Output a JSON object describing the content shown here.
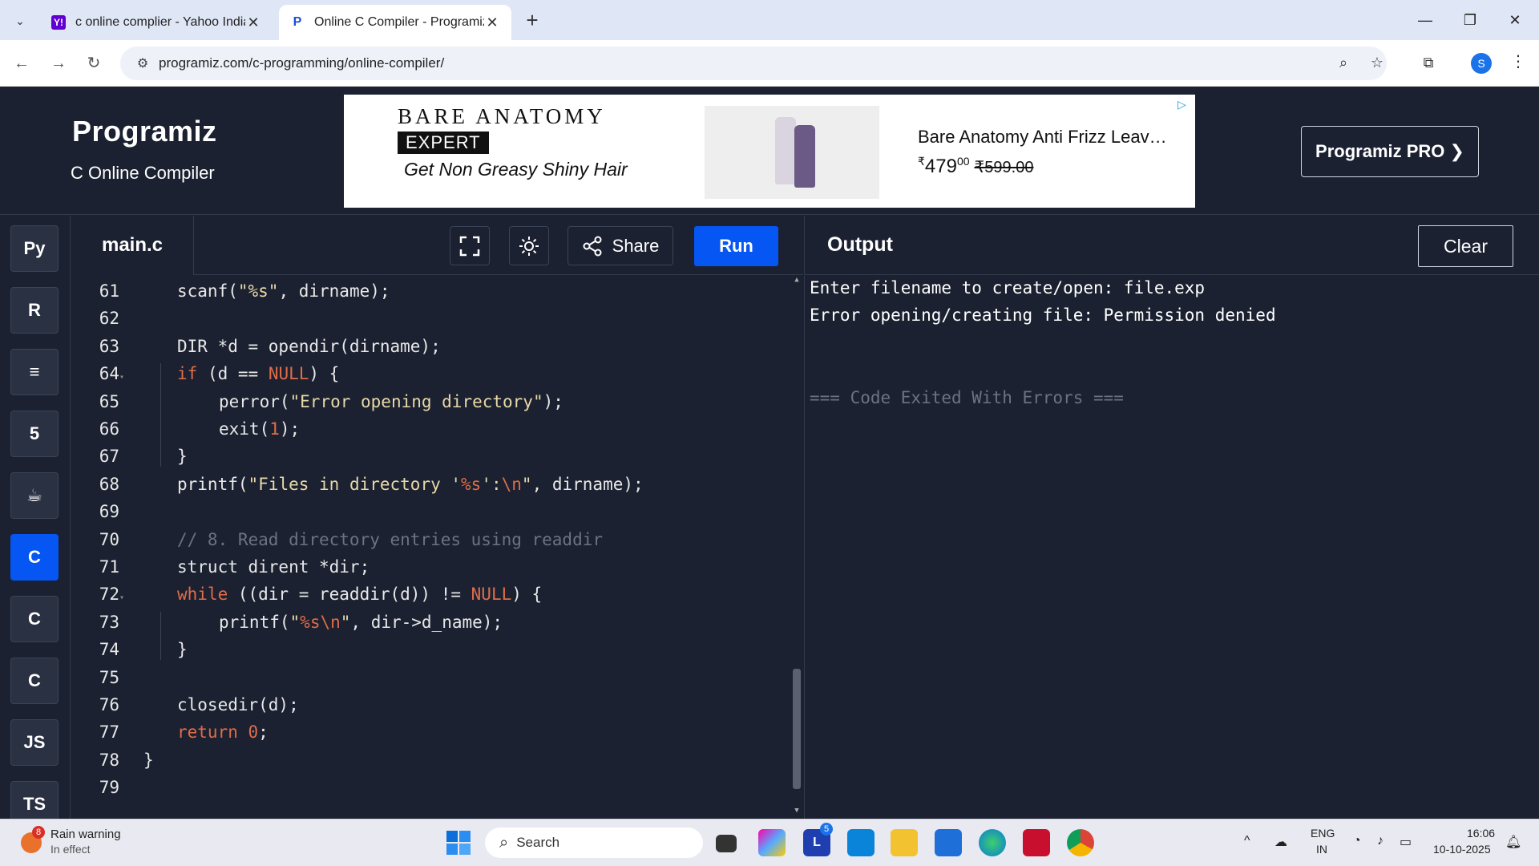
{
  "browser": {
    "tabs": [
      {
        "title": "c online complier - Yahoo India",
        "active": false
      },
      {
        "title": "Online C Compiler - Programiz",
        "active": true
      }
    ],
    "url": "programiz.com/c-programming/online-compiler/",
    "profile_initial": "S"
  },
  "header": {
    "logo": "Programiz",
    "subtitle": "C Online Compiler",
    "pro_button": "Programiz PRO ❯",
    "ad": {
      "brand": "BARE ANATOMY",
      "badge": "EXPERT",
      "tagline": "Get Non Greasy Shiny Hair",
      "product": "Bare Anatomy Anti Frizz Leav…",
      "price_symbol": "₹",
      "price_main": "479",
      "price_cents": "00",
      "old_price": "₹599.00"
    }
  },
  "sidebar": {
    "languages": [
      {
        "name": "python-icon",
        "label": "Py",
        "active": false
      },
      {
        "name": "r-icon",
        "label": "R",
        "active": false
      },
      {
        "name": "sql-icon",
        "label": "≡",
        "active": false
      },
      {
        "name": "html5-icon",
        "label": "5",
        "active": false
      },
      {
        "name": "java-icon",
        "label": "☕",
        "active": false
      },
      {
        "name": "c-icon",
        "label": "C",
        "active": true
      },
      {
        "name": "cpp-icon",
        "label": "C",
        "active": false
      },
      {
        "name": "csharp-icon",
        "label": "C",
        "active": false
      },
      {
        "name": "js-icon",
        "label": "JS",
        "active": false
      },
      {
        "name": "ts-icon",
        "label": "TS",
        "active": false
      }
    ]
  },
  "editor": {
    "filename": "main.c",
    "share_label": "Share",
    "run_label": "Run",
    "lines": [
      {
        "n": "61",
        "indent": 1,
        "code": [
          [
            "",
            "scanf("
          ],
          [
            "str",
            "\"%s\""
          ],
          [
            "",
            ", dirname);"
          ]
        ]
      },
      {
        "n": "62",
        "indent": 0,
        "code": []
      },
      {
        "n": "63",
        "indent": 1,
        "code": [
          [
            "",
            "DIR *d = opendir(dirname);"
          ]
        ]
      },
      {
        "n": "64",
        "indent": 1,
        "fold": true,
        "code": [
          [
            "kw",
            "if"
          ],
          [
            "",
            " (d == "
          ],
          [
            "kw",
            "NULL"
          ],
          [
            "",
            ") {"
          ]
        ]
      },
      {
        "n": "65",
        "indent": 2,
        "code": [
          [
            "",
            "perror("
          ],
          [
            "str",
            "\"Error opening directory\""
          ],
          [
            "",
            ");"
          ]
        ]
      },
      {
        "n": "66",
        "indent": 2,
        "code": [
          [
            "",
            "exit("
          ],
          [
            "num",
            "1"
          ],
          [
            "",
            ");"
          ]
        ]
      },
      {
        "n": "67",
        "indent": 1,
        "code": [
          [
            "",
            "}"
          ]
        ]
      },
      {
        "n": "68",
        "indent": 1,
        "code": [
          [
            "",
            "printf("
          ],
          [
            "str",
            "\"Files in directory '"
          ],
          [
            "kw",
            "%s"
          ],
          [
            "str",
            "':"
          ],
          [
            "kw",
            "\\n"
          ],
          [
            "str",
            "\""
          ],
          [
            "",
            ", dirname);"
          ]
        ]
      },
      {
        "n": "69",
        "indent": 0,
        "code": []
      },
      {
        "n": "70",
        "indent": 1,
        "code": [
          [
            "cm",
            "// 8. Read directory entries using readdir"
          ]
        ]
      },
      {
        "n": "71",
        "indent": 1,
        "code": [
          [
            "",
            "struct dirent *dir;"
          ]
        ]
      },
      {
        "n": "72",
        "indent": 1,
        "fold": true,
        "code": [
          [
            "kw",
            "while"
          ],
          [
            "",
            " ((dir = readdir(d)) != "
          ],
          [
            "kw",
            "NULL"
          ],
          [
            "",
            ") {"
          ]
        ]
      },
      {
        "n": "73",
        "indent": 2,
        "code": [
          [
            "",
            "printf("
          ],
          [
            "str",
            "\""
          ],
          [
            "kw",
            "%s\\n"
          ],
          [
            "str",
            "\""
          ],
          [
            "",
            ", dir->d_name);"
          ]
        ]
      },
      {
        "n": "74",
        "indent": 1,
        "code": [
          [
            "",
            "}"
          ]
        ]
      },
      {
        "n": "75",
        "indent": 0,
        "code": []
      },
      {
        "n": "76",
        "indent": 1,
        "code": [
          [
            "",
            "closedir(d);"
          ]
        ]
      },
      {
        "n": "77",
        "indent": 1,
        "code": [
          [
            "kw",
            "return"
          ],
          [
            "",
            " "
          ],
          [
            "num",
            "0"
          ],
          [
            "",
            ";"
          ]
        ]
      },
      {
        "n": "78",
        "indent": 0,
        "code": [
          [
            "",
            "}"
          ]
        ]
      },
      {
        "n": "79",
        "indent": 0,
        "code": []
      }
    ]
  },
  "output": {
    "title": "Output",
    "clear_label": "Clear",
    "lines": [
      "Enter filename to create/open: file.exp",
      "Error opening/creating file: Permission denied"
    ],
    "exit_message": "=== Code Exited With Errors ==="
  },
  "taskbar": {
    "weather_title": "Rain warning",
    "weather_sub": "In effect",
    "weather_badge": "8",
    "search_placeholder": "Search",
    "notif_badge": "5",
    "lang_top": "ENG",
    "lang_bottom": "IN",
    "time": "16:06",
    "date": "10-10-2025"
  }
}
